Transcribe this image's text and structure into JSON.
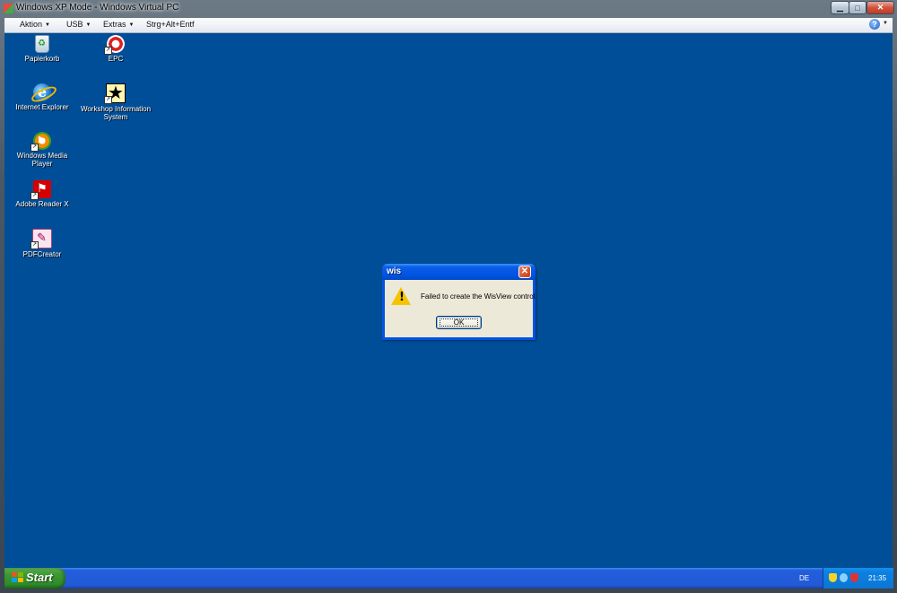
{
  "host": {
    "title": "Windows XP Mode - Windows Virtual PC",
    "caption_buttons": {
      "minimize": "▁",
      "maximize": "□",
      "close": "✕"
    },
    "menu": {
      "aktion": "Aktion",
      "usb": "USB",
      "extras": "Extras",
      "ctrl_alt_del": "Strg+Alt+Entf",
      "dropdown_arrow": "▼",
      "help": "?"
    }
  },
  "desktop": {
    "background_color": "#004e98",
    "icons": {
      "recycle_bin": "Papierkorb",
      "epc": "EPC",
      "internet_explorer": "Internet Explorer",
      "wis_line1": "Workshop Information",
      "wis_line2": "System",
      "wmp": "Windows Media Player",
      "adobe_reader": "Adobe Reader X",
      "pdfcreator": "PDFCreator"
    }
  },
  "dialog": {
    "title": "wis",
    "message": "Failed to create the WisView control.",
    "ok_label": "OK",
    "close_glyph": "✕"
  },
  "taskbar": {
    "start_label": "Start",
    "language": "DE",
    "clock": "21:35"
  }
}
